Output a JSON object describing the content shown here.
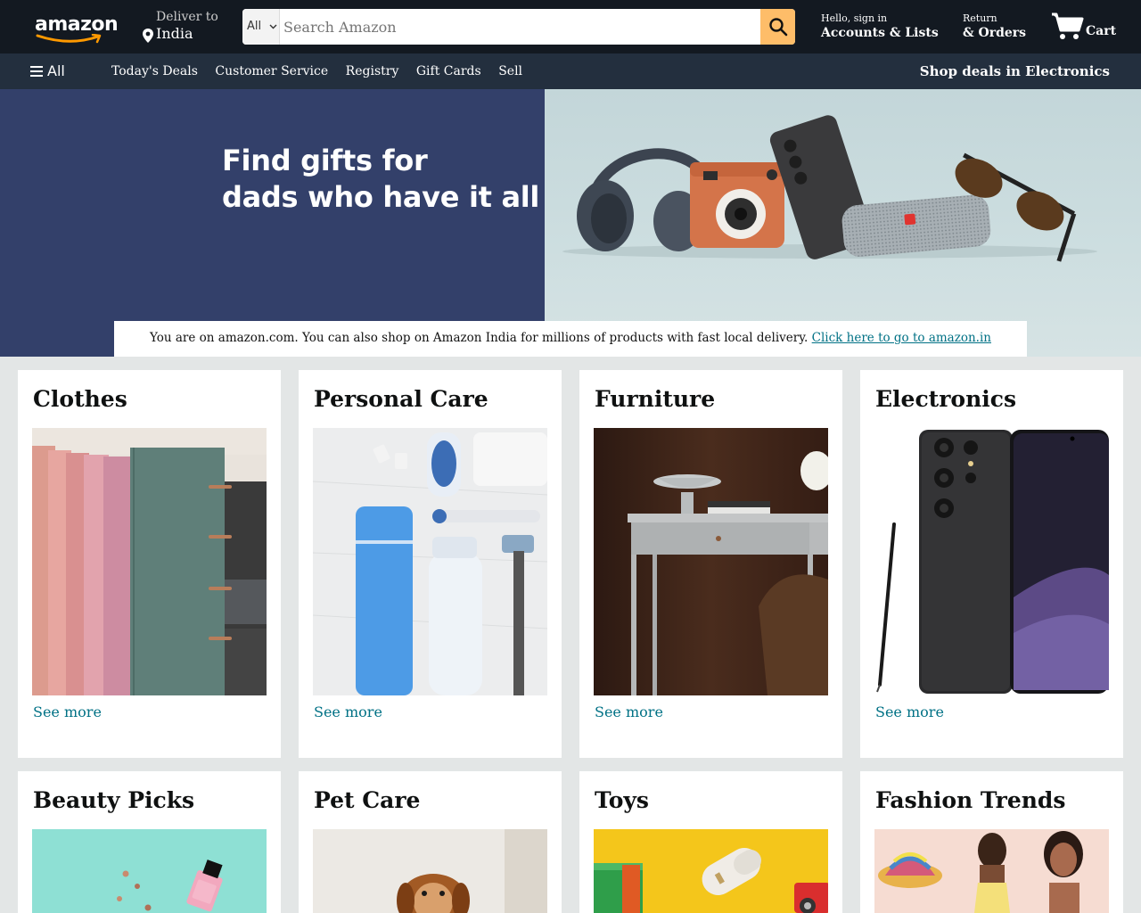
{
  "header": {
    "logo_text": "amazon",
    "deliver_label": "Deliver to",
    "deliver_location": "India",
    "search": {
      "category": "All",
      "placeholder": "Search Amazon",
      "value": ""
    },
    "account_small": "Hello, sign in",
    "account_bold": "Accounts & Lists",
    "orders_small": "Return",
    "orders_bold": "& Orders",
    "cart_label": "Cart"
  },
  "nav": {
    "all_label": "All",
    "links": [
      "Today's Deals",
      "Customer Service",
      "Registry",
      "Gift Cards",
      "Sell"
    ],
    "promo": "Shop deals in Electronics"
  },
  "hero": {
    "line1": "Find gifts for",
    "line2": "dads who have it all",
    "colors": {
      "left_bg": "#33406a",
      "right_bg": "#cddee0"
    }
  },
  "notice": {
    "text": "You are on amazon.com. You can also shop on Amazon India for millions of products with fast local delivery.",
    "link": "Click here to go to amazon.in"
  },
  "cards": [
    {
      "title": "Clothes",
      "link": "See more",
      "image": "clothes-image"
    },
    {
      "title": "Personal Care",
      "link": "See more",
      "image": "personal-care-image"
    },
    {
      "title": "Furniture",
      "link": "See more",
      "image": "furniture-image"
    },
    {
      "title": "Electronics",
      "link": "See more",
      "image": "electronics-image"
    },
    {
      "title": "Beauty Picks",
      "image": "beauty-image"
    },
    {
      "title": "Pet Care",
      "image": "pet-care-image"
    },
    {
      "title": "Toys",
      "image": "toys-image"
    },
    {
      "title": "Fashion Trends",
      "image": "fashion-image"
    }
  ],
  "colors": {
    "header": "#131921",
    "nav": "#232f3e",
    "search_button": "#febd69",
    "link": "#007185",
    "page_bg": "#e3e6e6"
  }
}
